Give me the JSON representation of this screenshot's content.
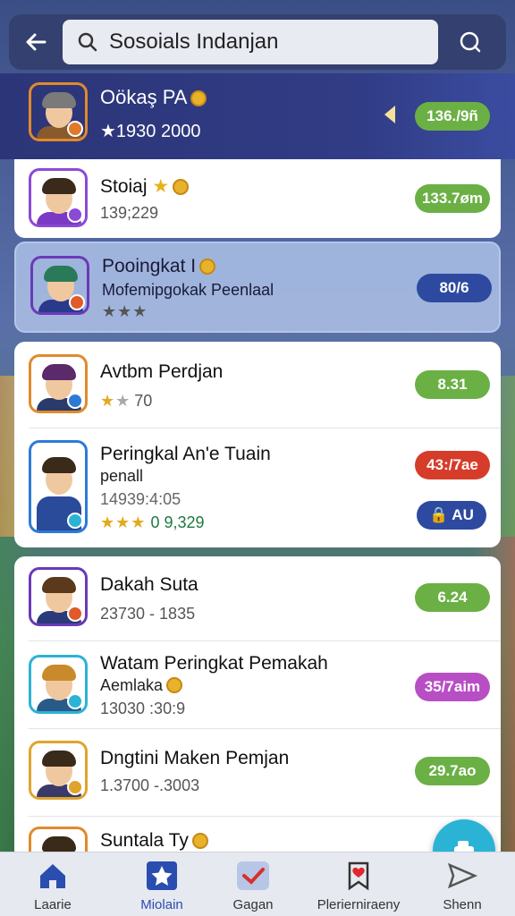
{
  "search": {
    "query": "Sosoials Indanjan"
  },
  "header_player": {
    "name": "Oökaş PA",
    "score": "★1930 2000",
    "value": "136./9ñ"
  },
  "rows": [
    {
      "name": "Stoiaj",
      "sub": "139;229",
      "value": "133.7øm",
      "color": "#6bb045"
    },
    {
      "name": "Pooingkat I",
      "sub": "Mofemipgokak Peenlaal",
      "stars": "★★★",
      "value": "80/6",
      "color": "#2d4aa0"
    },
    {
      "name": "Avtbm Perdjan",
      "stars_full": "★",
      "stars_dim": "★",
      "sub": "70",
      "value": "8.31",
      "color": "#6bb045"
    },
    {
      "name": "Peringkal An'e Tuain",
      "sub": "penall",
      "sub2": "14939:4:05",
      "stars": "★★★",
      "sub3": "0 9,329",
      "value": "43:/7ae",
      "value2": "AU",
      "color": "#d63c2a",
      "color2": "#2d4aa0"
    },
    {
      "name": "Dakah Suta",
      "sub": "23730 - 1835",
      "value": "6.24",
      "color": "#6bb045"
    },
    {
      "name": "Watam Peringkat Pemakah",
      "sub": "Aemlaka",
      "sub2": "13030 :30:9",
      "value": "35/7aim",
      "color": "#b84ec4"
    },
    {
      "name": "Dngtini Maken Pemjan",
      "sub": "1.3700 -.3003",
      "value": "29.7ao",
      "color": "#6bb045"
    },
    {
      "name": "Suntala Ty"
    }
  ],
  "nav": [
    {
      "label": "Laarie"
    },
    {
      "label": "Miolain"
    },
    {
      "label": "Gagan"
    },
    {
      "label": "Plerierniraeny"
    },
    {
      "label": "Shenn"
    }
  ],
  "colors": {
    "accent": "#2a4db0",
    "green": "#6bb045",
    "header_bg": "#2c3577"
  }
}
